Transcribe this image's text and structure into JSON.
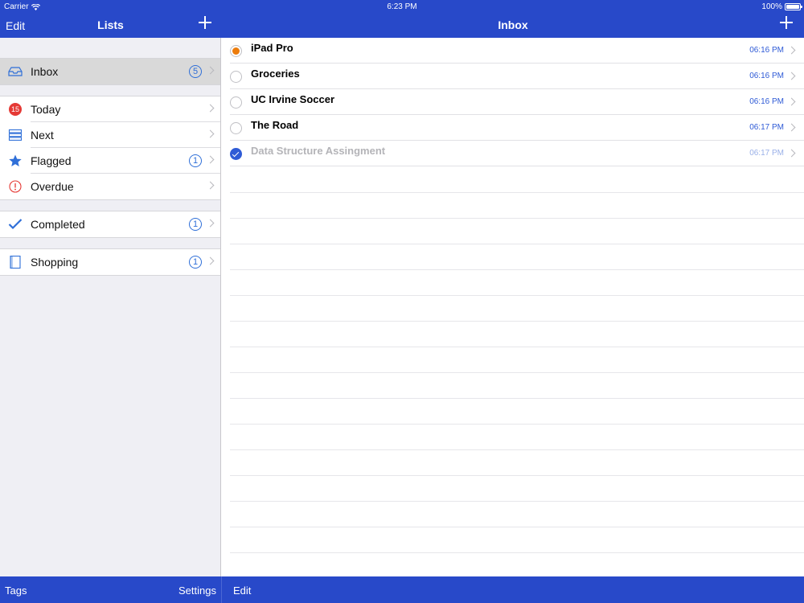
{
  "status": {
    "carrier": "Carrier",
    "time": "6:23 PM",
    "battery": "100%"
  },
  "sidebar_nav": {
    "edit": "Edit",
    "title": "Lists"
  },
  "main_nav": {
    "title": "Inbox"
  },
  "sidebar": {
    "inbox": {
      "label": "Inbox",
      "count": "5"
    },
    "today": {
      "label": "Today",
      "badge": "15"
    },
    "next": {
      "label": "Next"
    },
    "flagged": {
      "label": "Flagged",
      "count": "1"
    },
    "overdue": {
      "label": "Overdue"
    },
    "completed": {
      "label": "Completed",
      "count": "1"
    },
    "shopping": {
      "label": "Shopping",
      "count": "1"
    }
  },
  "tasks": [
    {
      "title": "iPad Pro",
      "time": "06:16 PM",
      "state": "priority"
    },
    {
      "title": "Groceries",
      "time": "06:16 PM",
      "state": "open"
    },
    {
      "title": "UC Irvine Soccer",
      "time": "06:16 PM",
      "state": "open"
    },
    {
      "title": "The Road",
      "time": "06:17 PM",
      "state": "open"
    },
    {
      "title": "Data Structure Assingment",
      "time": "06:17 PM",
      "state": "done"
    }
  ],
  "bottom": {
    "tags": "Tags",
    "settings": "Settings",
    "edit": "Edit"
  },
  "colors": {
    "bar": "#2849c9",
    "accent": "#2f5bd6",
    "priority": "#ec7c0b",
    "badge_red": "#e53935"
  },
  "icons": {
    "inbox": "inbox-tray-icon",
    "today": "calendar-badge-icon",
    "next": "stack-icon",
    "flagged": "star-icon",
    "overdue": "exclamation-circle-icon",
    "completed": "checkmark-icon",
    "shopping": "list-book-icon",
    "add": "plus-icon",
    "wifi": "wifi-icon",
    "battery": "battery-icon"
  }
}
